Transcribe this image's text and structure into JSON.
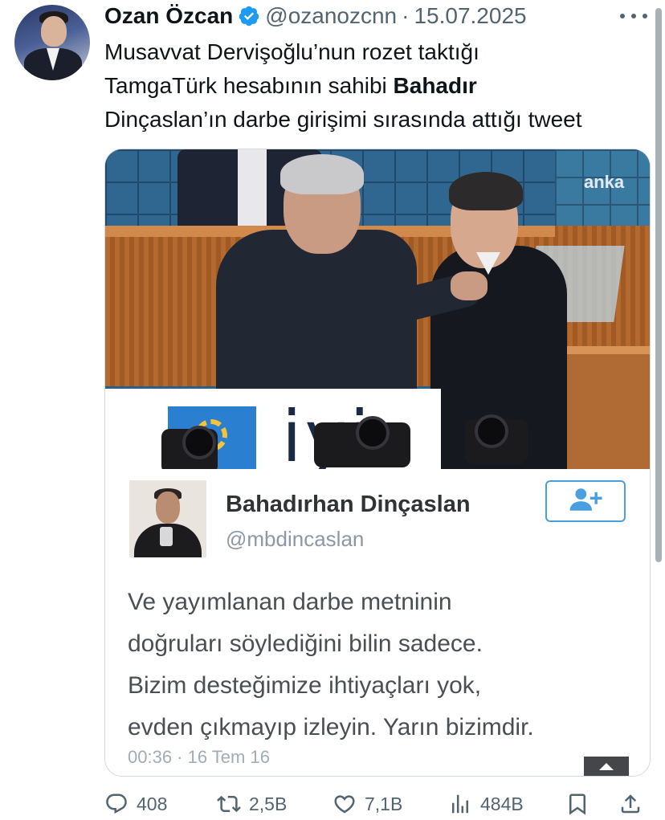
{
  "author": {
    "display_name": "Ozan Özcan",
    "handle": "@ozanozcnn",
    "separator": "·",
    "date": "15.07.2025"
  },
  "tweet": {
    "line1": "Musavvat Dervişoğlu’nun rozet taktığı",
    "line2_prefix": "TamgaTürk hesabının sahibi ",
    "line2_bold": "Bahadır",
    "line3": "Dinçaslan’ın darbe girişimi sırasında attığı tweet"
  },
  "photo": {
    "watermark": "anka",
    "podium_logo_text": "iyi"
  },
  "embedded_tweet": {
    "name": "Bahadırhan Dinçaslan",
    "handle": "@mbdincaslan",
    "text_lines": [
      "Ve yayımlanan darbe metninin",
      "doğruları söylediğini bilin sadece.",
      "Bizim desteğimize ihtiyaçları yok,",
      "evden çıkmayıp izleyin. Yarın bizimdir."
    ],
    "timestamp": "00:36 · 16 Tem 16"
  },
  "actions": {
    "replies": "408",
    "reposts": "2,5B",
    "likes": "7,1B",
    "views": "484B"
  },
  "colors": {
    "verified": "#1d9bf0",
    "text_primary": "#0f1419",
    "text_secondary": "#536471",
    "follow_accent": "#4a9fe0"
  },
  "icons": {
    "verified": "verified-badge-icon",
    "more": "more-dots-icon",
    "reply": "reply-bubble-icon",
    "repost": "repost-arrows-icon",
    "like": "heart-icon",
    "views": "views-bars-icon",
    "bookmark": "bookmark-icon",
    "share": "share-upload-icon",
    "follow": "add-user-icon"
  }
}
